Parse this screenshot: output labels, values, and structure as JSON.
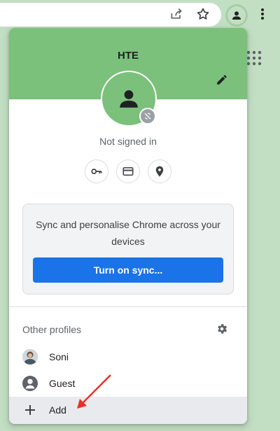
{
  "toolbar": {
    "icons": [
      "share-icon",
      "star-icon",
      "profile-avatar-icon",
      "more-vert-icon",
      "apps-grid-icon"
    ]
  },
  "profile_menu": {
    "profile_name": "HTE",
    "status": "Not signed in",
    "quick_actions": [
      "passwords-key-icon",
      "payment-card-icon",
      "addresses-pin-icon"
    ],
    "sync_promo": {
      "text": "Sync and personalise Chrome across your devices",
      "button_label": "Turn on sync..."
    },
    "other_profiles_title": "Other profiles",
    "profiles": [
      {
        "label": "Soni",
        "icon": "soni-avatar"
      },
      {
        "label": "Guest",
        "icon": "guest-icon"
      },
      {
        "label": "Add",
        "icon": "add-icon"
      }
    ]
  },
  "colors": {
    "accent_green": "#7bc17b",
    "background_green": "#c3dfc3",
    "sync_button_blue": "#1a73e8",
    "annotation_arrow_red": "#e8302a"
  }
}
